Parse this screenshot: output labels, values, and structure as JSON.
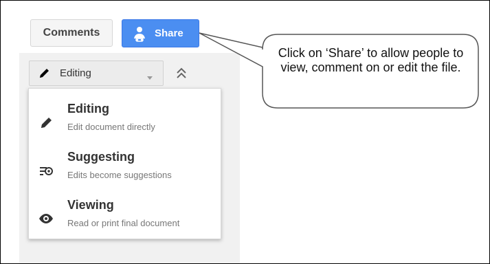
{
  "toolbar": {
    "comments_label": "Comments",
    "share_label": "Share",
    "share_icon": "share-person-icon",
    "share_color": "#4b8ef1"
  },
  "mode_selector": {
    "current_mode": "Editing",
    "pencil_icon": "pencil-icon",
    "dropdown_icon": "chevron-down-icon",
    "collapse_icon": "double-chevron-up-icon"
  },
  "menu": {
    "items": [
      {
        "title": "Editing",
        "description": "Edit document directly",
        "icon": "pencil-icon"
      },
      {
        "title": "Suggesting",
        "description": "Edits become suggestions",
        "icon": "suggest-icon"
      },
      {
        "title": "Viewing",
        "description": "Read or print final document",
        "icon": "eye-icon"
      }
    ]
  },
  "callout": {
    "text": "Click on ‘Share’ to allow people to view, comment on or edit the file."
  }
}
